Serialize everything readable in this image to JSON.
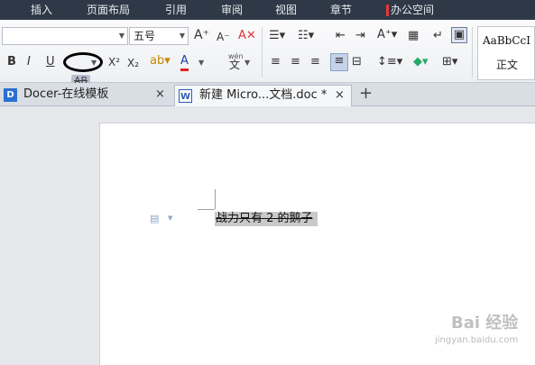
{
  "menu": {
    "items": [
      "插入",
      "页面布局",
      "引用",
      "审阅",
      "视图",
      "章节",
      "办公空间"
    ]
  },
  "ribbon": {
    "font_size": "五号",
    "style_sample": "AaBbCcI",
    "style_name": "正文",
    "bold": "B",
    "italic": "I",
    "underline": "U",
    "strikethrough": "AB",
    "superscript": "X²",
    "subscript": "X₂",
    "font_color": "A",
    "phonetic": "wén",
    "phonetic_char": "文",
    "grow_font": "A⁺",
    "shrink_font": "A⁻"
  },
  "tabs": [
    {
      "label": "Docer-在线模板",
      "icon": "D",
      "close": "×"
    },
    {
      "label": "新建 Micro...文档.doc *",
      "icon": "W",
      "close": "×"
    }
  ],
  "new_tab": "+",
  "document": {
    "selected_text": "战力只有 2 的鹅子"
  },
  "watermark": {
    "main": "Bai 经验",
    "sub": "jingyan.baidu.com"
  },
  "colors": {
    "menubar_bg": "#2f3846",
    "selection": "#c9c9c9",
    "accent_red": "#e23a3a"
  }
}
